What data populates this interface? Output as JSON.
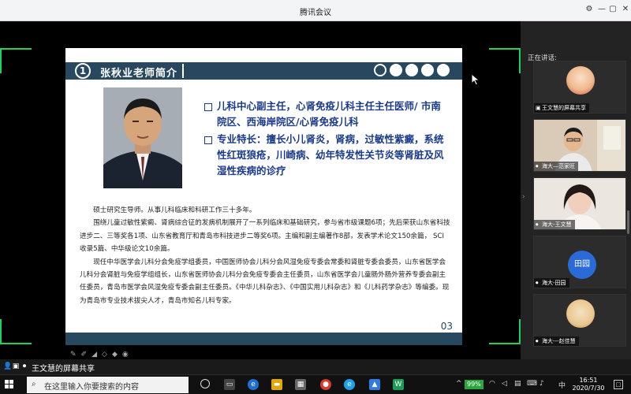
{
  "app": {
    "title": "腾讯会议"
  },
  "window_controls": {
    "settings": "⚙",
    "minimize": "—",
    "restore": "▢",
    "close": "✕"
  },
  "slide": {
    "section_number": "1",
    "title": "张秋业老师简介",
    "bullets": [
      "儿科中心副主任，心肾免疫儿科主任主任医师/ 市南院区、西海岸院区/心肾免疫儿科",
      "专业特长：擅长小儿肾炎，肾病，过敏性紫癜，系统性红斑狼疮，川崎病、幼年特发性关节炎等肾脏及风湿性疾病的诊疗"
    ],
    "bio": [
      "硕士研究生导师。从事儿科临床和科研工作三十多年。",
      "围绕儿童过敏性紫癜、肾病综合征的发病机制展开了一系列临床和基础研究，参与省市级课题6项；先后荣获山东省科技进步二、三等奖各1项、山东省教育厅和青岛市科技进步二等奖6项。主编和副主编著作8部，发表学术论文150余篇， SCI收录5篇、中华级论文10余篇。",
      "现任中华医学会儿科分会免疫学组委员，中国医师协会儿科分会风湿免疫专委会常委和肾脏专委会委员，山东省医学会儿科分会肾脏与免疫学组组长，山东省医师协会儿科分会免疫专委会主任委员，山东省医学会儿童肠外肠外营养专委会副主任委员，青岛市医学会风湿免疫专委会副主任委员。《中华儿科杂志》、《中国实用儿科杂志》和《儿科药学杂志》等编委。现为青岛市专业技术拔尖人才，青岛市知名儿科专家。"
    ],
    "page_number": "03"
  },
  "annotation_tools": [
    "✎",
    "✐",
    "◢",
    "◇",
    "◆",
    "◉"
  ],
  "share_label": "王文慧的屏幕共享",
  "panel": {
    "speaking_label": "正在讲话:",
    "participants": [
      {
        "name": "王文慧的屏幕共享",
        "kind": "avatar-image"
      },
      {
        "name": "海大—范家旺",
        "kind": "video"
      },
      {
        "name": "海大-王文慧",
        "kind": "video"
      },
      {
        "name": "海大-田园",
        "kind": "initials",
        "initials": "田园"
      },
      {
        "name": "海大---赵佳慧",
        "kind": "avatar-image"
      }
    ]
  },
  "taskbar": {
    "search_placeholder": "在这里输入你要搜索的内容",
    "battery": "99%",
    "ime": "中",
    "time": "16:51",
    "date": "2020/7/30",
    "notification": "□"
  },
  "colors": {
    "slide_header": "#27485e",
    "bullet_text": "#1a3a8a",
    "focus_corner": "#1fd35a",
    "initials_avatar": "#2a6bd8",
    "battery": "#2ba63f"
  },
  "icons": [
    "settings-icon",
    "minimize-icon",
    "restore-icon",
    "close-icon",
    "cursor-icon",
    "microphone-icon",
    "windows-start-icon",
    "search-icon",
    "task-view-icon",
    "edge-icon",
    "chrome-icon"
  ]
}
